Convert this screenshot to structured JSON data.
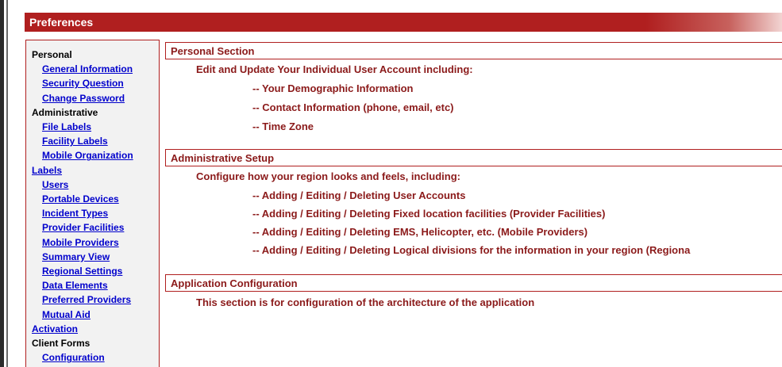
{
  "window": {
    "title": "Preferences"
  },
  "sidebar": {
    "items": [
      {
        "label": "Personal",
        "kind": "group"
      },
      {
        "label": "General Information",
        "kind": "link"
      },
      {
        "label": "Security Question",
        "kind": "link"
      },
      {
        "label": "Change Password",
        "kind": "link"
      },
      {
        "label": "Administrative",
        "kind": "group"
      },
      {
        "label": "File Labels",
        "kind": "link"
      },
      {
        "label": "Facility Labels",
        "kind": "link"
      },
      {
        "label": "Mobile Organization",
        "kind": "link"
      },
      {
        "label": "Labels",
        "kind": "toplink"
      },
      {
        "label": "Users",
        "kind": "link"
      },
      {
        "label": "Portable Devices",
        "kind": "link"
      },
      {
        "label": "Incident Types",
        "kind": "link"
      },
      {
        "label": "Provider Facilities",
        "kind": "link"
      },
      {
        "label": "Mobile Providers",
        "kind": "link"
      },
      {
        "label": "Summary View",
        "kind": "link"
      },
      {
        "label": "Regional Settings",
        "kind": "link"
      },
      {
        "label": "Data Elements",
        "kind": "link"
      },
      {
        "label": "Preferred Providers",
        "kind": "link"
      },
      {
        "label": "Mutual Aid",
        "kind": "link"
      },
      {
        "label": "Activation",
        "kind": "toplink"
      },
      {
        "label": "Client Forms",
        "kind": "group"
      },
      {
        "label": "Configuration",
        "kind": "link"
      }
    ]
  },
  "sections": {
    "personal": {
      "title": "Personal Section",
      "intro": "Edit and Update Your Individual User Account including:",
      "bullets": [
        "-- Your Demographic Information",
        "-- Contact Information (phone, email, etc)",
        "-- Time Zone"
      ]
    },
    "administrative": {
      "title": "Administrative Setup",
      "intro": "Configure how your region looks and feels, including:",
      "bullets": [
        "-- Adding / Editing / Deleting User Accounts",
        "-- Adding / Editing / Deleting Fixed location facilities (Provider Facilities)",
        "-- Adding / Editing / Deleting EMS, Helicopter, etc. (Mobile Providers)",
        "-- Adding / Editing / Deleting Logical divisions for the information in your region (Regiona"
      ]
    },
    "application": {
      "title": "Application Configuration",
      "intro": "This section is for configuration of the architecture of the application"
    }
  }
}
